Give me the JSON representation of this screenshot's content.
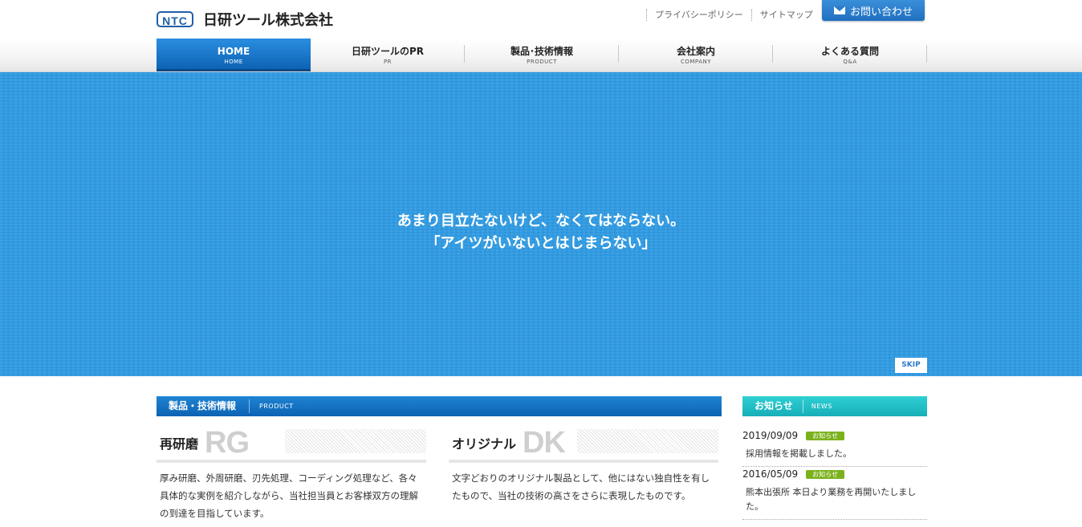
{
  "header": {
    "logo_mark": "NTC",
    "company_name": "日研ツール株式会社",
    "util_links": [
      "プライバシーポリシー",
      "サイトマップ"
    ],
    "contact_label": "お問い合わせ"
  },
  "nav": [
    {
      "jp": "HOME",
      "en": "HOME",
      "active": true
    },
    {
      "jp": "日研ツールのPR",
      "en": "PR"
    },
    {
      "jp": "製品･技術情報",
      "en": "PRODUCT"
    },
    {
      "jp": "会社案内",
      "en": "COMPANY"
    },
    {
      "jp": "よくある質問",
      "en": "Q&A"
    }
  ],
  "hero": {
    "line1": "あまり目立たないけど、なくてはならない。",
    "line2": "「アイツがいないとはじまらない」",
    "skip_label": "SKIP",
    "bg_color": "#2f9be3"
  },
  "products": {
    "title": "製品・技術情報",
    "title_en": "PRODUCT",
    "cards": [
      {
        "title": "再研磨",
        "code": "RG",
        "text": "厚み研磨、外周研磨、刃先処理、コーディング処理など、各々具体的な実例を紹介しながら、当社担当員とお客様双方の理解の到達を目指しています。"
      },
      {
        "title": "オリジナル",
        "code": "DK",
        "text": "文字どおりのオリジナル製品として、他にはない独自性を有したもので、当社の技術の高さをさらに表現したものです。"
      }
    ]
  },
  "news": {
    "title": "お知らせ",
    "title_en": "NEWS",
    "items": [
      {
        "date": "2019/09/09",
        "badge": "お知らせ",
        "text": "採用情報を掲載しました。"
      },
      {
        "date": "2016/05/09",
        "badge": "お知らせ",
        "text": "熊本出張所 本日より業務を再開いたしました。"
      }
    ]
  },
  "colors": {
    "brand_blue": "#1f6fc0",
    "news_teal": "#17aeb8",
    "badge_green": "#7bb21c"
  }
}
